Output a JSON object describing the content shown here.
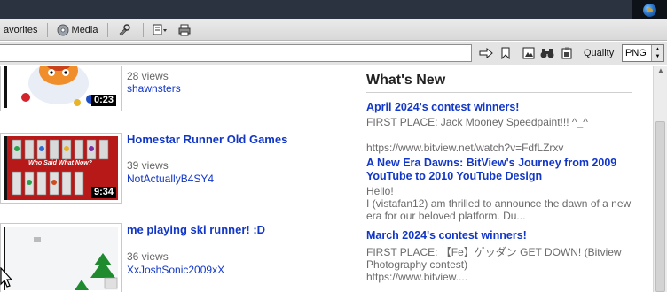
{
  "toolbar": {
    "favorites_label": "avorites",
    "media_label": "Media"
  },
  "address_bar": {
    "quality_label": "Quality",
    "quality_value": "PNG"
  },
  "videos": [
    {
      "views": "28 views",
      "user": "shawnsters",
      "duration": "0:23"
    },
    {
      "title": "Homestar Runner Old Games",
      "views": "39 views",
      "user": "NotActuallyB4SY4",
      "duration": "9:34",
      "thumb_caption": "Who Said What Now?"
    },
    {
      "title": "me playing ski runner! :D",
      "views": "36 views",
      "user": "XxJoshSonic2009xX"
    }
  ],
  "whats_new": {
    "heading": "What's New",
    "items": [
      {
        "title": "April 2024's contest winners!",
        "body_line1": "FIRST PLACE: Jack Mooney Speedpaint!!! ^_^",
        "body_line2": "https://www.bitview.net/watch?v=FdfLZrxv"
      },
      {
        "title": "A New Era Dawns: BitView's Journey from 2009 YouTube to 2010 YouTube Design",
        "body_line1": "Hello!",
        "body_line2": "I (vistafan12) am thrilled to announce the dawn of a new era for our beloved platform. Du..."
      },
      {
        "title": "March 2024's contest winners!",
        "body_line1": "FIRST PLACE: 【Fe】ゲッダン GET DOWN! (Bitview Photography contest)",
        "body_line2": "https://www.bitview...."
      }
    ]
  },
  "colors": {
    "link": "#1237c7",
    "topbar": "#2b3341"
  }
}
